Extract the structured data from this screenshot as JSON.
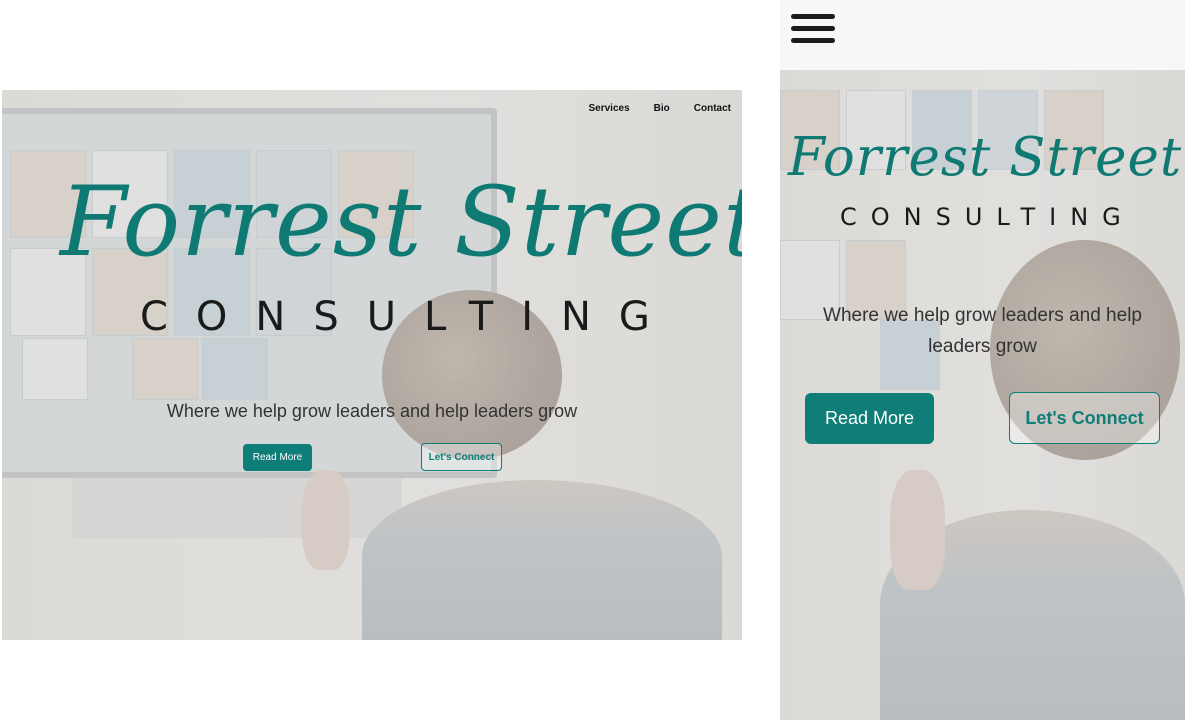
{
  "desktop": {
    "nav": {
      "items": [
        "Services",
        "Bio",
        "Contact"
      ]
    },
    "logo": {
      "script": "Forrest Street",
      "sub": "CONSULTING"
    },
    "tagline": "Where we help grow leaders and help leaders grow",
    "buttons": {
      "read_more": "Read More",
      "connect": "Let's Connect"
    }
  },
  "mobile": {
    "menu_icon": "hamburger-menu-icon",
    "logo": {
      "script": "Forrest Street",
      "sub": "CONSULTING"
    },
    "tagline_line1": "Where we help grow leaders and help",
    "tagline_line2": "leaders grow",
    "buttons": {
      "read_more": "Read More",
      "connect": "Let's Connect"
    }
  },
  "colors": {
    "brand_teal": "#0f7d78",
    "text_dark": "#1a1a1a"
  }
}
